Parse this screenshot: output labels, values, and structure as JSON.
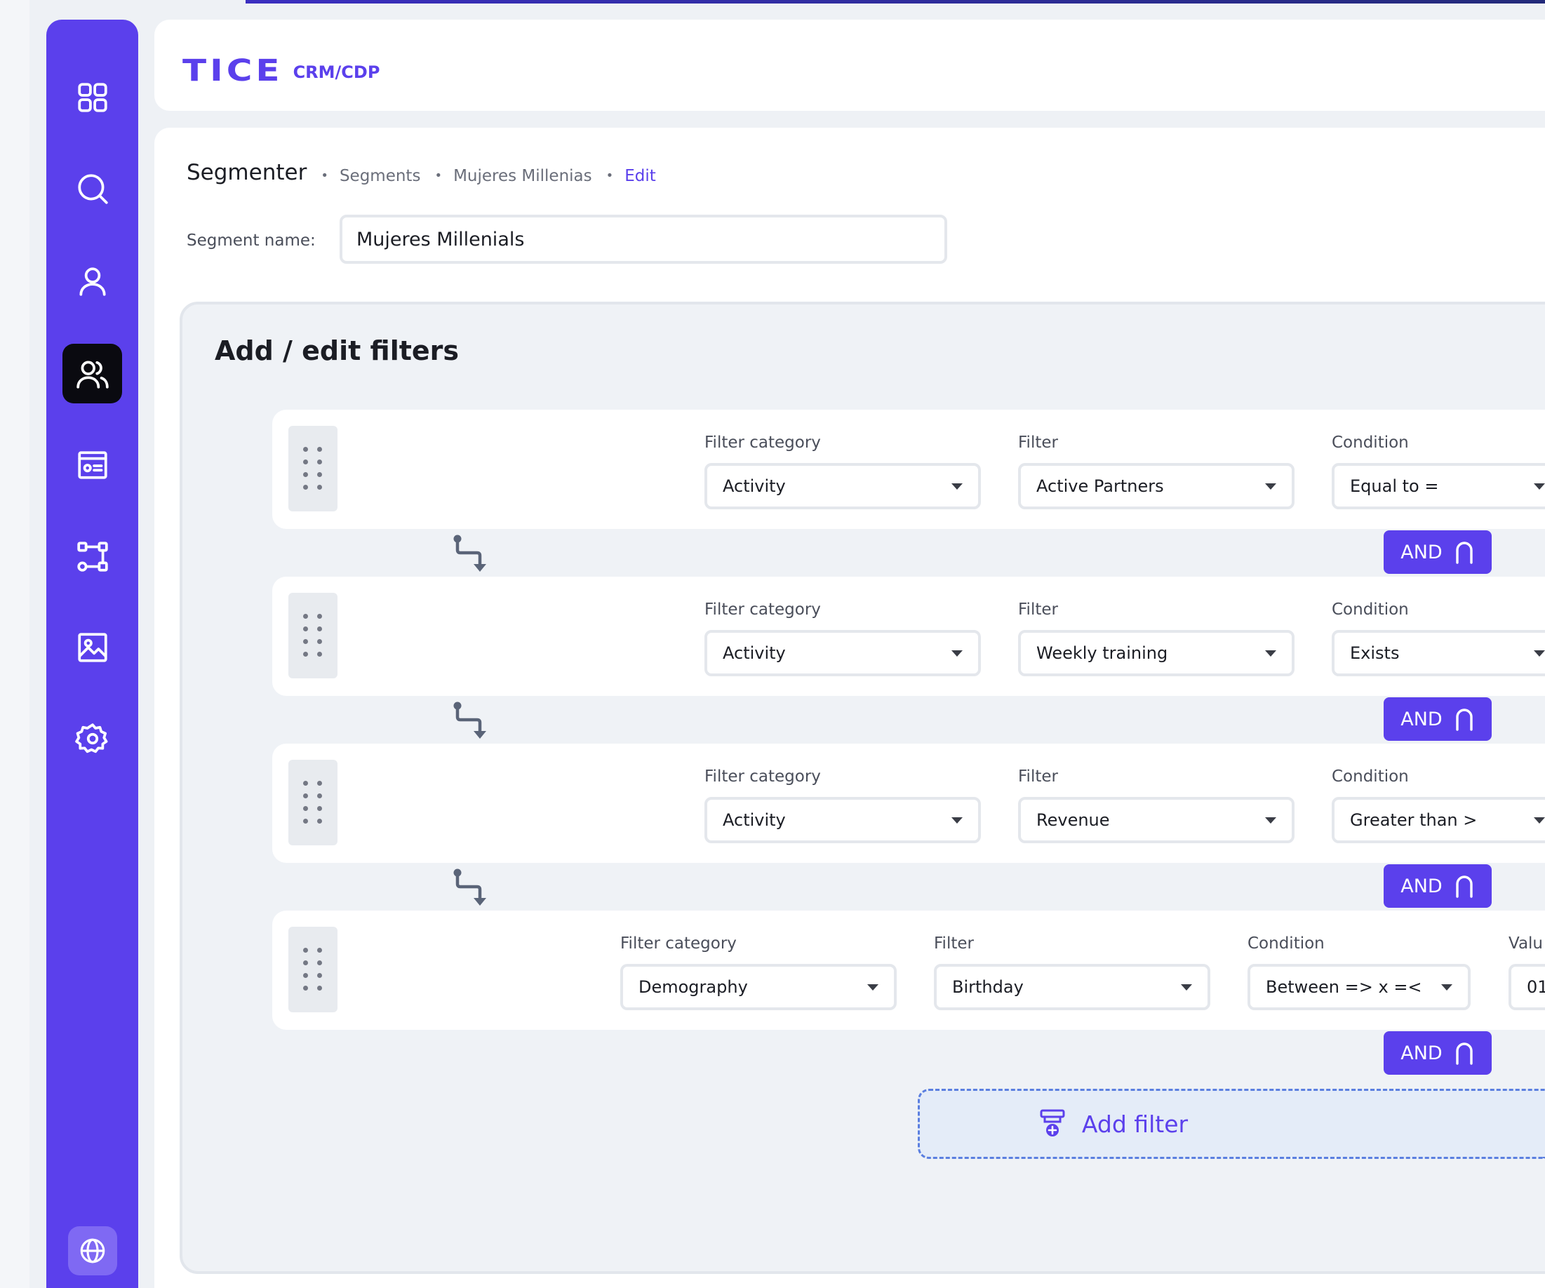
{
  "app": {
    "logo_main": "TICE",
    "logo_sub": "CRM/CDP"
  },
  "breadcrumb": {
    "title": "Segmenter",
    "items": [
      "Segments",
      "Mujeres Millenias",
      "Edit"
    ]
  },
  "segment": {
    "label": "Segment name:",
    "value": "Mujeres Millenials"
  },
  "filters": {
    "title": "Add / edit filters",
    "and_label": "AND",
    "add_label": "Add filter",
    "rows": [
      {
        "category_label": "Filter category",
        "category": "Activity",
        "filter_label": "Filter",
        "filter": "Active Partners",
        "condition_label": "Condition",
        "condition": "Equal to ="
      },
      {
        "category_label": "Filter category",
        "category": "Activity",
        "filter_label": "Filter",
        "filter": "Weekly training",
        "condition_label": "Condition",
        "condition": "Exists"
      },
      {
        "category_label": "Filter category",
        "category": "Activity",
        "filter_label": "Filter",
        "filter": "Revenue",
        "condition_label": "Condition",
        "condition": "Greater than >"
      },
      {
        "category_label": "Filter category",
        "category": "Demography",
        "filter_label": "Filter",
        "filter": "Birthday",
        "condition_label": "Condition",
        "condition": "Between => x =<",
        "value_label": "Valu",
        "value": "01"
      }
    ]
  },
  "sidebar": {
    "icons": [
      "dashboard-icon",
      "search-icon",
      "user-icon",
      "users-icon",
      "id-card-icon",
      "workflow-icon",
      "image-icon",
      "settings-icon",
      "globe-icon"
    ]
  },
  "colors": {
    "brand": "#5b40ec",
    "active_nav": "#0a0a10",
    "add_filter_border": "#5b7fe0"
  }
}
